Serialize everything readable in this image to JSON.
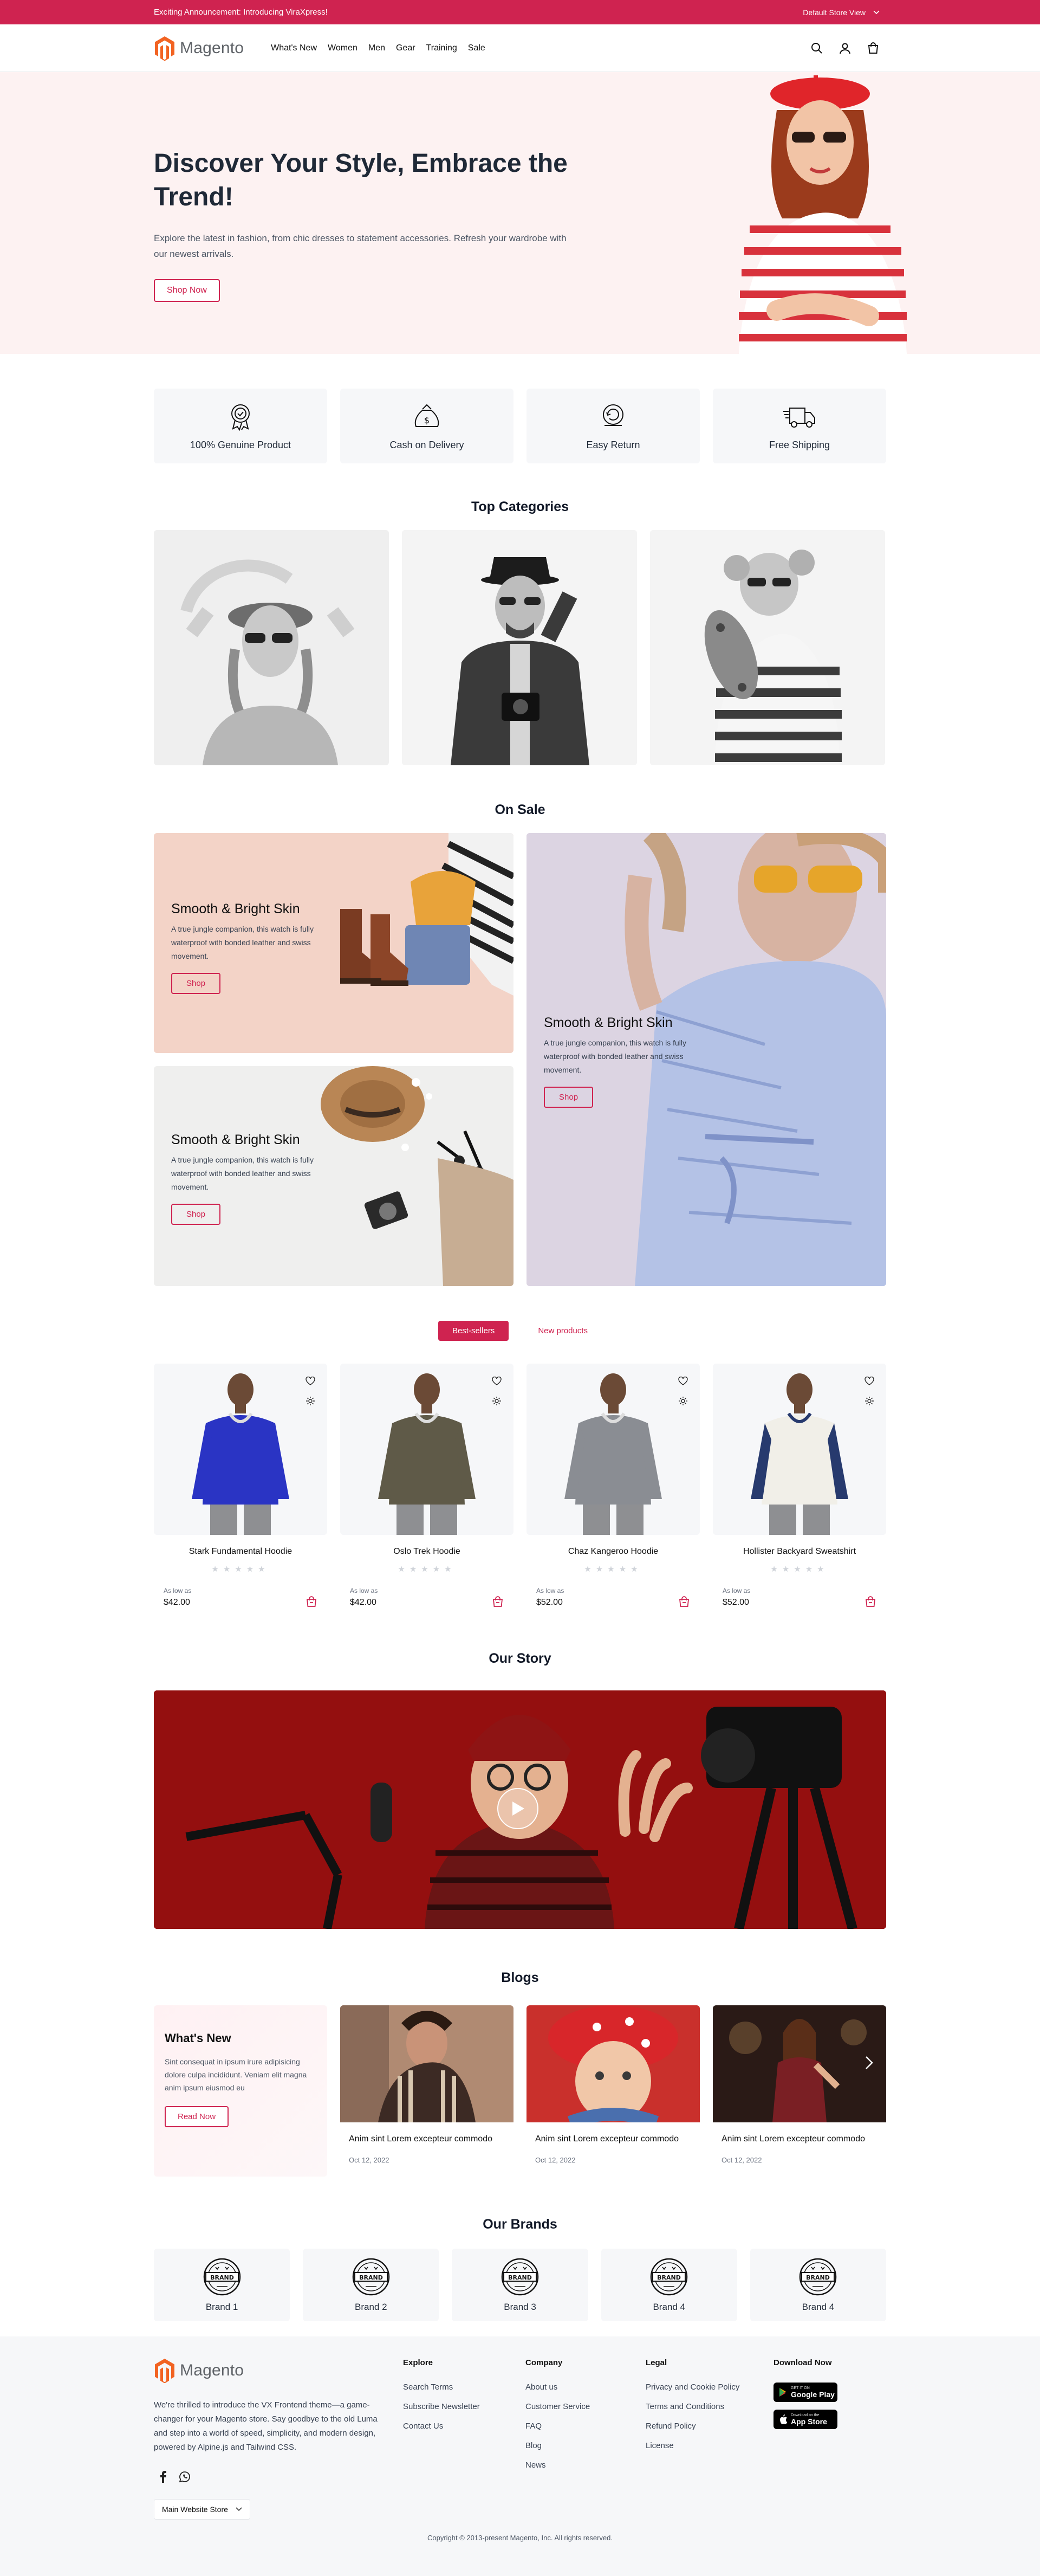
{
  "announcement": {
    "text": "Exciting Announcement: Introducing ViraXpress!",
    "store_view": "Default Store View"
  },
  "header": {
    "logo_text": "Magento",
    "nav": [
      "What's New",
      "Women",
      "Men",
      "Gear",
      "Training",
      "Sale"
    ],
    "icons": [
      "search-icon",
      "account-icon",
      "cart-icon"
    ]
  },
  "hero": {
    "title": "Discover Your Style, Embrace the Trend!",
    "text": "Explore the latest in fashion, from chic dresses to statement accessories. Refresh your wardrobe with our newest arrivals.",
    "button": "Shop Now"
  },
  "features": [
    {
      "label": "100% Genuine Product",
      "icon": "genuine-badge-icon"
    },
    {
      "label": "Cash on Delivery",
      "icon": "cash-bag-icon"
    },
    {
      "label": "Easy Return",
      "icon": "easy-return-icon"
    },
    {
      "label": "Free Shipping",
      "icon": "truck-icon"
    }
  ],
  "categories": {
    "title": "Top Categories"
  },
  "on_sale": {
    "title": "On Sale",
    "cards": [
      {
        "title": "Smooth & Bright Skin",
        "text": "A true jungle companion, this watch is fully waterproof with bonded leather and swiss movement.",
        "button": "Shop"
      },
      {
        "title": "Smooth & Bright Skin",
        "text": "A true jungle companion, this watch is fully waterproof with bonded leather and swiss movement.",
        "button": "Shop"
      },
      {
        "title": "Smooth & Bright Skin",
        "text": "A true jungle companion, this watch is fully waterproof with bonded leather and swiss movement.",
        "button": "Shop"
      }
    ]
  },
  "product_tabs": [
    "Best-sellers",
    "New products"
  ],
  "products": [
    {
      "name": "Stark Fundamental Hoodie",
      "as_low_as": "As low as",
      "price": "$42.00",
      "stars": "★★★★★",
      "color": "#2a34c4"
    },
    {
      "name": "Oslo Trek Hoodie",
      "as_low_as": "As low as",
      "price": "$42.00",
      "stars": "★★★★★",
      "color": "#5f5a48"
    },
    {
      "name": "Chaz Kangeroo Hoodie",
      "as_low_as": "As low as",
      "price": "$52.00",
      "stars": "★★★★★",
      "color": "#8a8d93"
    },
    {
      "name": "Hollister Backyard Sweatshirt",
      "as_low_as": "As low as",
      "price": "$52.00",
      "stars": "★★★★★",
      "color": "#f1efe8"
    }
  ],
  "story": {
    "title": "Our Story"
  },
  "blogs": {
    "title": "Blogs",
    "intro": {
      "title": "What's New",
      "text": "Sint consequat in ipsum irure adipisicing dolore culpa incididunt. Veniam elit magna anim ipsum eiusmod eu",
      "button": "Read Now"
    },
    "items": [
      {
        "title": "Anim sint Lorem excepteur commodo",
        "date": "Oct 12, 2022"
      },
      {
        "title": "Anim sint Lorem excepteur commodo",
        "date": "Oct 12, 2022"
      },
      {
        "title": "Anim sint Lorem excepteur commodo",
        "date": "Oct 12, 2022"
      }
    ]
  },
  "brands": {
    "title": "Our Brands",
    "logo_text": "BRAND",
    "items": [
      "Brand 1",
      "Brand 2",
      "Brand 3",
      "Brand 4",
      "Brand 4"
    ]
  },
  "footer": {
    "logo_text": "Magento",
    "about": "We're thrilled to introduce the VX Frontend theme—a game-changer for your Magento store. Say goodbye to the old Luma and step into a world of speed, simplicity, and modern design, powered by Alpine.js and Tailwind CSS.",
    "store_select": "Main Website Store",
    "columns": [
      {
        "title": "Explore",
        "links": [
          "Search Terms",
          "Subscribe Newsletter",
          "Contact Us"
        ]
      },
      {
        "title": "Company",
        "links": [
          "About us",
          "Customer Service",
          "FAQ",
          "Blog",
          "News"
        ]
      },
      {
        "title": "Legal",
        "links": [
          "Privacy and Cookie Policy",
          "Terms and Conditions",
          "Refund Policy",
          "License"
        ]
      }
    ],
    "download": {
      "title": "Download Now",
      "google_small": "GET IT ON",
      "google": "Google Play",
      "apple_small": "Download on the",
      "apple": "App Store"
    },
    "copyright": "Copyright © 2013-present Magento, Inc. All rights reserved."
  },
  "colors": {
    "brand": "#cf2350",
    "hero_bg": "#fdf2f2",
    "card_bg": "#f6f7f9"
  }
}
